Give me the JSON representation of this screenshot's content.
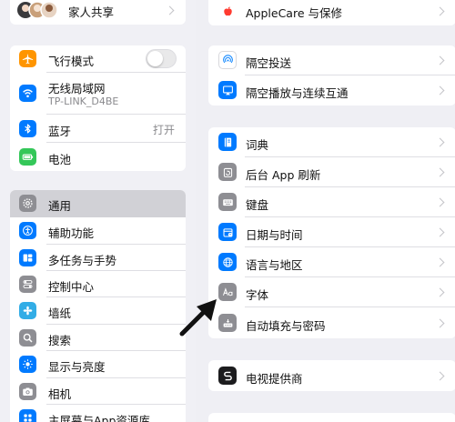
{
  "sidebar": {
    "family": {
      "label": "家人共享"
    },
    "connectivity": [
      {
        "label": "飞行模式",
        "icon": "airplane-icon",
        "color": "#ff9500"
      },
      {
        "label": "无线局域网",
        "sublabel": "TP-LINK_D4BE",
        "icon": "wifi-icon",
        "color": "#007aff"
      },
      {
        "label": "蓝牙",
        "value": "打开",
        "icon": "bluetooth-icon",
        "color": "#007aff"
      },
      {
        "label": "电池",
        "icon": "battery-icon",
        "color": "#34c759"
      }
    ],
    "general": [
      {
        "label": "通用",
        "icon": "gear-icon",
        "color": "#8e8e93",
        "selected": true
      },
      {
        "label": "辅助功能",
        "icon": "accessibility-icon",
        "color": "#007aff"
      },
      {
        "label": "多任务与手势",
        "icon": "multitasking-icon",
        "color": "#007aff"
      },
      {
        "label": "控制中心",
        "icon": "control-center-icon",
        "color": "#8e8e93"
      },
      {
        "label": "墙纸",
        "icon": "wallpaper-icon",
        "color": "#32ade6"
      },
      {
        "label": "搜索",
        "icon": "search-icon",
        "color": "#8e8e93"
      },
      {
        "label": "显示与亮度",
        "icon": "brightness-icon",
        "color": "#007aff"
      },
      {
        "label": "相机",
        "icon": "camera-icon",
        "color": "#8e8e93"
      },
      {
        "label": "主屏幕与App资源库",
        "icon": "home-screen-icon",
        "color": "#007aff"
      }
    ]
  },
  "main": {
    "applecare": {
      "label": "AppleCare 与保修",
      "icon": "apple-icon",
      "color": "#ff3b30"
    },
    "airplay": [
      {
        "label": "隔空投送",
        "icon": "airdrop-icon",
        "color": "#ffffff"
      },
      {
        "label": "隔空播放与连续互通",
        "icon": "airplay-icon",
        "color": "#007aff"
      }
    ],
    "settings": [
      {
        "label": "词典",
        "icon": "dictionary-icon",
        "color": "#007aff"
      },
      {
        "label": "后台 App 刷新",
        "icon": "refresh-icon",
        "color": "#8e8e93"
      },
      {
        "label": "键盘",
        "icon": "keyboard-icon",
        "color": "#8e8e93"
      },
      {
        "label": "日期与时间",
        "icon": "calendar-icon",
        "color": "#007aff"
      },
      {
        "label": "语言与地区",
        "icon": "globe-icon",
        "color": "#007aff"
      },
      {
        "label": "字体",
        "icon": "font-icon",
        "color": "#8e8e93"
      },
      {
        "label": "自动填充与密码",
        "icon": "password-icon",
        "color": "#8e8e93"
      }
    ],
    "tv_provider": {
      "label": "电视提供商",
      "icon": "tv-provider-icon",
      "color": "#1c1c1e"
    }
  },
  "overlay": {
    "arrow_color": "#111111"
  }
}
